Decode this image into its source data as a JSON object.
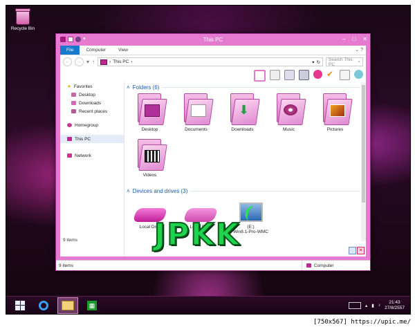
{
  "desktop": {
    "recycle_bin_label": "Recycle Bin"
  },
  "window": {
    "title": "This PC",
    "ribbon_tabs": [
      "File",
      "Computer",
      "View"
    ],
    "address": {
      "path": "This PC"
    },
    "search_placeholder": "Search This PC",
    "navigation": {
      "favorites": "Favorites",
      "favorite_items": [
        "Desktop",
        "Downloads",
        "Recent places"
      ],
      "homegroup": "Homegroup",
      "this_pc": "This PC",
      "network": "Network"
    },
    "folders_header": "Folders (6)",
    "folders": [
      "Desktop",
      "Documents",
      "Downloads",
      "Music",
      "Pictures",
      "Videos"
    ],
    "drives_header": "Devices and drives (3)",
    "drives": [
      "Local Disk",
      "Local Disk",
      "Win8.1-Pro-WMC"
    ],
    "drive_partial_label": "(E:)",
    "items_count_inner": "9 items",
    "status_items": "9 items",
    "status_location": "Computer"
  },
  "watermark": "JPKK",
  "taskbar": {
    "time": "21:43",
    "date": "27/8/2557"
  },
  "caption": "[750x567] https://upic.me/",
  "colors": {
    "accent": "#e57ad0",
    "file_tab": "#1979ca",
    "watermark": "#1ed44e"
  }
}
